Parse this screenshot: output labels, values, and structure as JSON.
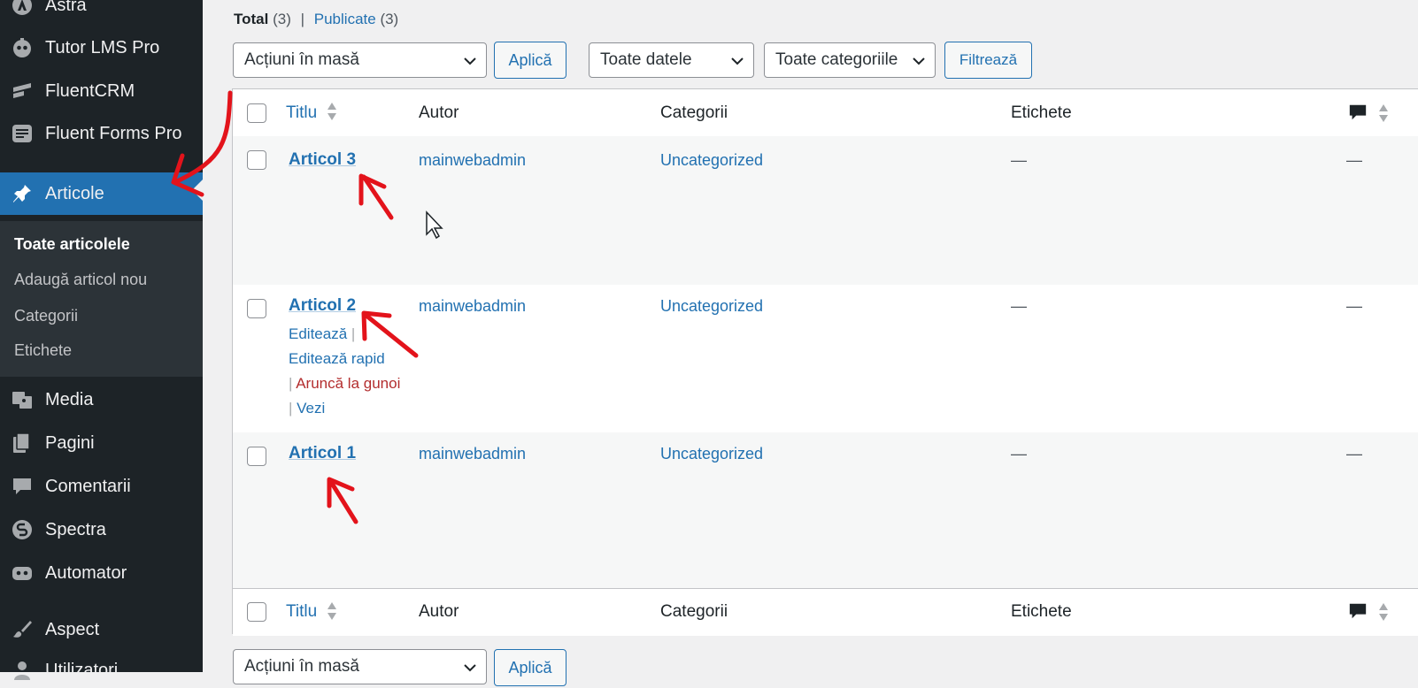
{
  "sidebar": {
    "items": [
      {
        "label": "Astra",
        "icon": "astra-icon"
      },
      {
        "label": "Tutor LMS Pro",
        "icon": "tutor-icon"
      },
      {
        "label": "FluentCRM",
        "icon": "fluentcrm-icon"
      },
      {
        "label": "Fluent Forms Pro",
        "icon": "fluentforms-icon"
      },
      {
        "label": "Articole",
        "icon": "pin-icon"
      },
      {
        "label": "Media",
        "icon": "media-icon"
      },
      {
        "label": "Pagini",
        "icon": "pages-icon"
      },
      {
        "label": "Comentarii",
        "icon": "comment-icon"
      },
      {
        "label": "Spectra",
        "icon": "spectra-icon"
      },
      {
        "label": "Automator",
        "icon": "automator-icon"
      },
      {
        "label": "Aspect",
        "icon": "brush-icon"
      },
      {
        "label": "Utilizatori",
        "icon": "users-icon"
      }
    ],
    "submenu": [
      "Toate articolele",
      "Adaugă articol nou",
      "Categorii",
      "Etichete"
    ]
  },
  "views": {
    "total_label": "Total",
    "total_count": "(3)",
    "separator": "|",
    "published_label": "Publicate",
    "published_count": "(3)"
  },
  "filters": {
    "bulk_actions": "Acțiuni în masă",
    "apply": "Aplică",
    "all_dates": "Toate datele",
    "all_categories": "Toate categoriile",
    "filter": "Filtrează"
  },
  "table": {
    "columns": {
      "title": "Titlu",
      "author": "Autor",
      "categories": "Categorii",
      "tags": "Etichete"
    },
    "rows": [
      {
        "title": "Articol 3",
        "author": "mainwebadmin",
        "category": "Uncategorized",
        "tags": "—",
        "comments": "—"
      },
      {
        "title": "Articol 2",
        "author": "mainwebadmin",
        "category": "Uncategorized",
        "tags": "—",
        "comments": "—"
      },
      {
        "title": "Articol 1",
        "author": "mainwebadmin",
        "category": "Uncategorized",
        "tags": "—",
        "comments": "—"
      }
    ],
    "row_actions": {
      "edit": "Editează",
      "quick_edit": "Editează rapid",
      "trash": "Aruncă la gunoi",
      "view": "Vezi",
      "sep": "|"
    }
  },
  "colors": {
    "sidebar_bg": "#1d2327",
    "active_menu": "#2271b1",
    "link": "#2271b1",
    "trash": "#b32d2e",
    "annotation": "#e3131b"
  }
}
